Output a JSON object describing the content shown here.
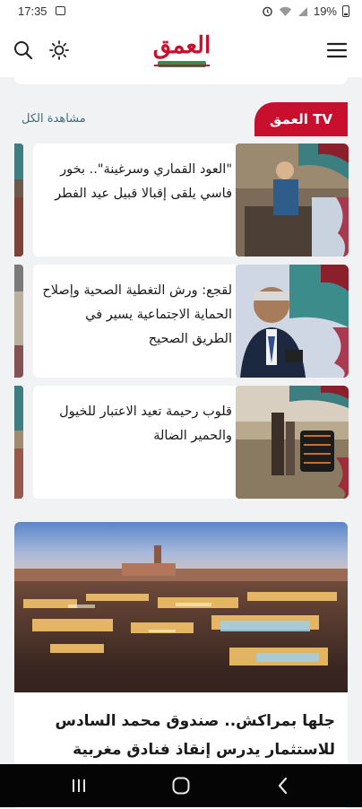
{
  "status_bar": {
    "time": "17:35",
    "battery": "19%"
  },
  "app_bar": {
    "menu_icon": "hamburger-menu-icon",
    "logo_text": "العمق",
    "theme_icon": "sun-icon",
    "search_icon": "search-icon"
  },
  "tv_section": {
    "badge_label": "العمق TV",
    "see_all_label": "مشاهدة الكل",
    "items": [
      {
        "title": "\"العود القماري وسرغينة\".. بخور فاسي يلقى إقبالا قبيل عيد الفطر"
      },
      {
        "title": "لقجع: ورش التغطية الصحية وإصلاح الحماية الاجتماعية يسير في الطريق الصحيح"
      },
      {
        "title": "قلوب رحيمة تعيد الاعتبار للخيول والحمير الضالة"
      }
    ]
  },
  "feature": {
    "title": "جلها بمراكش.. صندوق محمد السادس للاستثمار يدرس إنقاذ فنادق مغربية"
  },
  "colors": {
    "brand_red": "#c8102e",
    "brand_green": "#2f8f4e",
    "link_teal": "#3d6f77"
  }
}
